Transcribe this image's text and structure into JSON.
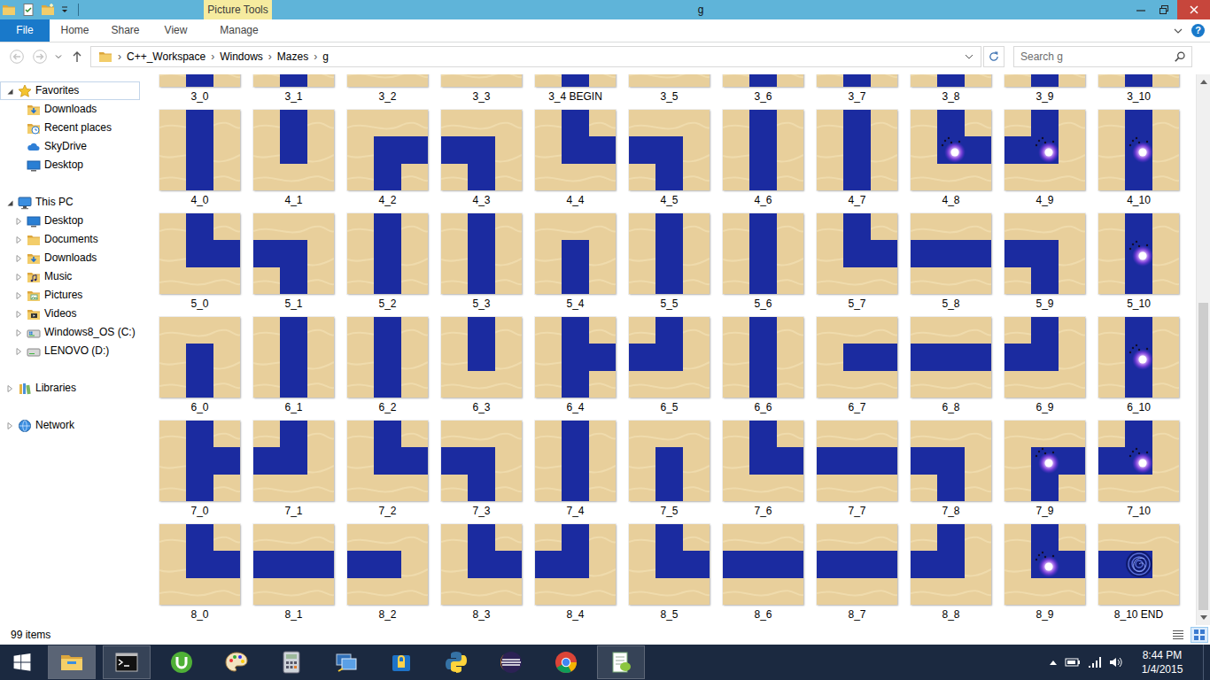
{
  "window": {
    "title": "g",
    "context_tab": "Picture Tools"
  },
  "ribbon": {
    "tabs": [
      {
        "label": "File",
        "kind": "file",
        "selected": false
      },
      {
        "label": "Home",
        "kind": "tab",
        "selected": false
      },
      {
        "label": "Share",
        "kind": "tab",
        "selected": false
      },
      {
        "label": "View",
        "kind": "tab",
        "selected": false
      },
      {
        "label": "Manage",
        "kind": "context",
        "selected": false
      }
    ],
    "help": "?"
  },
  "address": {
    "buttons": [
      {
        "kind": "back",
        "disabled": true
      },
      {
        "kind": "forward",
        "disabled": true
      },
      {
        "kind": "recent",
        "disabled": false
      },
      {
        "kind": "up",
        "disabled": false
      }
    ],
    "separator": "›",
    "path": [
      "C++_Workspace",
      "Windows",
      "Mazes",
      "g"
    ]
  },
  "search": {
    "placeholder": "Search g"
  },
  "nav": {
    "groups": [
      {
        "label": "Favorites",
        "kind": "star",
        "expanded": true,
        "selected": true,
        "children": [
          {
            "label": "Downloads",
            "kind": "downloads",
            "selected": false
          },
          {
            "label": "Recent places",
            "kind": "recent",
            "selected": false
          },
          {
            "label": "SkyDrive",
            "kind": "skydrive",
            "selected": false
          },
          {
            "label": "Desktop",
            "kind": "desktop",
            "selected": false
          }
        ]
      },
      {
        "label": "This PC",
        "kind": "pc",
        "expanded": true,
        "selected": false,
        "children": [
          {
            "label": "Desktop",
            "kind": "desktop",
            "expanded": false,
            "selected": false
          },
          {
            "label": "Documents",
            "kind": "folder",
            "expanded": false,
            "selected": false
          },
          {
            "label": "Downloads",
            "kind": "downloads",
            "expanded": false,
            "selected": false
          },
          {
            "label": "Music",
            "kind": "music",
            "expanded": false,
            "selected": false
          },
          {
            "label": "Pictures",
            "kind": "pictures",
            "expanded": false,
            "selected": false
          },
          {
            "label": "Videos",
            "kind": "videos",
            "expanded": false,
            "selected": false
          },
          {
            "label": "Windows8_OS (C:)",
            "kind": "drive",
            "expanded": false,
            "selected": false
          },
          {
            "label": "LENOVO (D:)",
            "kind": "disk",
            "expanded": false,
            "selected": false
          }
        ]
      },
      {
        "label": "Libraries",
        "kind": "libraries",
        "expanded": false,
        "selected": false,
        "children": []
      },
      {
        "label": "Network",
        "kind": "network",
        "expanded": false,
        "selected": false,
        "children": []
      }
    ]
  },
  "grid": {
    "rows": [
      {
        "tiles": [
          {
            "label": "3_0",
            "s": true,
            "kind": "plain"
          },
          {
            "label": "3_1",
            "s": true,
            "kind": "plain"
          },
          {
            "label": "3_2",
            "s": false,
            "kind": "plain"
          },
          {
            "label": "3_3",
            "s": false,
            "kind": "plain"
          },
          {
            "label": "3_4 BEGIN",
            "s": true,
            "kind": "plain"
          },
          {
            "label": "3_5",
            "s": false,
            "kind": "plain"
          },
          {
            "label": "3_6",
            "s": true,
            "kind": "plain"
          },
          {
            "label": "3_7",
            "s": true,
            "kind": "plain"
          },
          {
            "label": "3_8",
            "s": true,
            "kind": "plain"
          },
          {
            "label": "3_9",
            "s": true,
            "kind": "plain"
          },
          {
            "label": "3_10",
            "s": true,
            "kind": "plain"
          }
        ]
      },
      {
        "tiles": [
          {
            "label": "4_0",
            "n": true,
            "e": false,
            "s": true,
            "w": false,
            "kind": "plain"
          },
          {
            "label": "4_1",
            "n": true,
            "e": false,
            "s": false,
            "w": false,
            "kind": "plain"
          },
          {
            "label": "4_2",
            "n": false,
            "e": true,
            "s": true,
            "w": false,
            "kind": "plain"
          },
          {
            "label": "4_3",
            "n": false,
            "e": false,
            "s": true,
            "w": true,
            "kind": "plain"
          },
          {
            "label": "4_4",
            "n": true,
            "e": true,
            "s": false,
            "w": false,
            "kind": "plain"
          },
          {
            "label": "4_5",
            "n": false,
            "e": false,
            "s": true,
            "w": true,
            "kind": "plain"
          },
          {
            "label": "4_6",
            "n": true,
            "e": false,
            "s": true,
            "w": false,
            "kind": "plain"
          },
          {
            "label": "4_7",
            "n": true,
            "e": false,
            "s": true,
            "w": false,
            "kind": "plain"
          },
          {
            "label": "4_8",
            "n": true,
            "e": true,
            "s": false,
            "w": false,
            "kind": "monster"
          },
          {
            "label": "4_9",
            "n": true,
            "e": false,
            "s": false,
            "w": true,
            "kind": "monster"
          },
          {
            "label": "4_10",
            "n": true,
            "e": false,
            "s": true,
            "w": false,
            "kind": "monster"
          }
        ]
      },
      {
        "tiles": [
          {
            "label": "5_0",
            "n": true,
            "e": true,
            "s": false,
            "w": false,
            "kind": "plain"
          },
          {
            "label": "5_1",
            "n": false,
            "e": false,
            "s": true,
            "w": true,
            "kind": "plain"
          },
          {
            "label": "5_2",
            "n": true,
            "e": false,
            "s": true,
            "w": false,
            "kind": "plain"
          },
          {
            "label": "5_3",
            "n": true,
            "e": false,
            "s": true,
            "w": false,
            "kind": "plain"
          },
          {
            "label": "5_4",
            "n": false,
            "e": false,
            "s": true,
            "w": false,
            "kind": "plain"
          },
          {
            "label": "5_5",
            "n": true,
            "e": false,
            "s": true,
            "w": false,
            "kind": "plain"
          },
          {
            "label": "5_6",
            "n": true,
            "e": false,
            "s": true,
            "w": false,
            "kind": "plain"
          },
          {
            "label": "5_7",
            "n": true,
            "e": true,
            "s": false,
            "w": false,
            "kind": "plain"
          },
          {
            "label": "5_8",
            "n": false,
            "e": true,
            "s": false,
            "w": true,
            "kind": "plain"
          },
          {
            "label": "5_9",
            "n": false,
            "e": false,
            "s": true,
            "w": true,
            "kind": "plain"
          },
          {
            "label": "5_10",
            "n": true,
            "e": false,
            "s": true,
            "w": false,
            "kind": "monster"
          }
        ]
      },
      {
        "tiles": [
          {
            "label": "6_0",
            "n": false,
            "e": false,
            "s": true,
            "w": false,
            "kind": "plain"
          },
          {
            "label": "6_1",
            "n": true,
            "e": false,
            "s": true,
            "w": false,
            "kind": "plain"
          },
          {
            "label": "6_2",
            "n": true,
            "e": false,
            "s": true,
            "w": false,
            "kind": "plain"
          },
          {
            "label": "6_3",
            "n": true,
            "e": false,
            "s": false,
            "w": false,
            "kind": "plain"
          },
          {
            "label": "6_4",
            "n": true,
            "e": true,
            "s": true,
            "w": false,
            "kind": "plain"
          },
          {
            "label": "6_5",
            "n": true,
            "e": false,
            "s": false,
            "w": true,
            "kind": "plain"
          },
          {
            "label": "6_6",
            "n": true,
            "e": false,
            "s": true,
            "w": false,
            "kind": "plain"
          },
          {
            "label": "6_7",
            "n": false,
            "e": true,
            "s": false,
            "w": false,
            "kind": "plain"
          },
          {
            "label": "6_8",
            "n": false,
            "e": true,
            "s": false,
            "w": true,
            "kind": "plain"
          },
          {
            "label": "6_9",
            "n": true,
            "e": false,
            "s": false,
            "w": true,
            "kind": "plain"
          },
          {
            "label": "6_10",
            "n": true,
            "e": false,
            "s": true,
            "w": false,
            "kind": "monster"
          }
        ]
      },
      {
        "tiles": [
          {
            "label": "7_0",
            "n": true,
            "e": true,
            "s": true,
            "w": false,
            "kind": "plain"
          },
          {
            "label": "7_1",
            "n": true,
            "e": false,
            "s": false,
            "w": true,
            "kind": "plain"
          },
          {
            "label": "7_2",
            "n": true,
            "e": true,
            "s": false,
            "w": false,
            "kind": "plain"
          },
          {
            "label": "7_3",
            "n": false,
            "e": false,
            "s": true,
            "w": true,
            "kind": "plain"
          },
          {
            "label": "7_4",
            "n": true,
            "e": false,
            "s": true,
            "w": false,
            "kind": "plain"
          },
          {
            "label": "7_5",
            "n": false,
            "e": false,
            "s": true,
            "w": false,
            "kind": "plain"
          },
          {
            "label": "7_6",
            "n": true,
            "e": true,
            "s": false,
            "w": false,
            "kind": "plain"
          },
          {
            "label": "7_7",
            "n": false,
            "e": true,
            "s": false,
            "w": true,
            "kind": "plain"
          },
          {
            "label": "7_8",
            "n": false,
            "e": false,
            "s": true,
            "w": true,
            "kind": "plain"
          },
          {
            "label": "7_9",
            "n": false,
            "e": true,
            "s": true,
            "w": false,
            "kind": "monster"
          },
          {
            "label": "7_10",
            "n": true,
            "e": false,
            "s": false,
            "w": true,
            "kind": "monster"
          }
        ]
      },
      {
        "tiles": [
          {
            "label": "8_0",
            "n": true,
            "e": true,
            "s": false,
            "w": false,
            "kind": "plain"
          },
          {
            "label": "8_1",
            "n": false,
            "e": true,
            "s": false,
            "w": true,
            "kind": "plain"
          },
          {
            "label": "8_2",
            "n": false,
            "e": false,
            "s": false,
            "w": true,
            "kind": "plain"
          },
          {
            "label": "8_3",
            "n": true,
            "e": true,
            "s": false,
            "w": false,
            "kind": "plain"
          },
          {
            "label": "8_4",
            "n": true,
            "e": false,
            "s": false,
            "w": true,
            "kind": "plain"
          },
          {
            "label": "8_5",
            "n": true,
            "e": true,
            "s": false,
            "w": false,
            "kind": "plain"
          },
          {
            "label": "8_6",
            "n": false,
            "e": true,
            "s": false,
            "w": true,
            "kind": "plain"
          },
          {
            "label": "8_7",
            "n": false,
            "e": true,
            "s": false,
            "w": true,
            "kind": "plain"
          },
          {
            "label": "8_8",
            "n": true,
            "e": false,
            "s": false,
            "w": true,
            "kind": "plain"
          },
          {
            "label": "8_9",
            "n": true,
            "e": true,
            "s": false,
            "w": false,
            "kind": "monster"
          },
          {
            "label": "8_10 END",
            "n": false,
            "e": false,
            "s": false,
            "w": true,
            "kind": "portal"
          }
        ]
      }
    ]
  },
  "scrollbar": {
    "offset": 0.41,
    "level": 0.59
  },
  "status_bar": {
    "count": "99 items",
    "views": [
      {
        "kind": "details",
        "selected": false
      },
      {
        "kind": "large-icons",
        "selected": true
      }
    ]
  },
  "taskbar": {
    "apps": [
      {
        "kind": "explorer",
        "open": true,
        "active": true
      },
      {
        "kind": "cmd",
        "open": true,
        "active": false
      },
      {
        "kind": "utorrent",
        "open": false,
        "active": false
      },
      {
        "kind": "paint",
        "open": false,
        "active": false
      },
      {
        "kind": "calculator",
        "open": false,
        "active": false
      },
      {
        "kind": "remote",
        "open": false,
        "active": false
      },
      {
        "kind": "security",
        "open": false,
        "active": false
      },
      {
        "kind": "python",
        "open": false,
        "active": false
      },
      {
        "kind": "eclipse",
        "open": false,
        "active": false
      },
      {
        "kind": "chrome",
        "open": false,
        "active": false
      },
      {
        "kind": "notepadpp",
        "open": true,
        "active": false
      }
    ],
    "clock": {
      "time": "8:44 PM",
      "date": "1/4/2015"
    }
  }
}
